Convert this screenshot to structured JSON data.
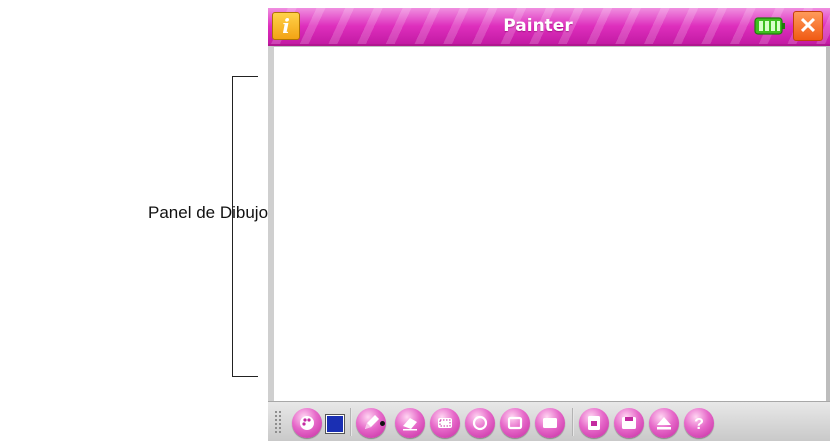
{
  "annotation": {
    "label": "Panel de Dibujo"
  },
  "window": {
    "title": "Painter",
    "info_glyph": "i",
    "close_glyph": "✕",
    "battery_color": "#3fbf1f",
    "titlebar_color": "#de2fbd"
  },
  "toolbar": {
    "current_color": "#1a2fb3",
    "tools": [
      {
        "name": "palette-icon"
      },
      {
        "name": "pencil-icon"
      },
      {
        "name": "eraser-icon"
      },
      {
        "name": "selection-icon"
      },
      {
        "name": "circle-icon"
      },
      {
        "name": "rectangle-outline-icon"
      },
      {
        "name": "rectangle-filled-icon"
      },
      {
        "name": "new-document-icon"
      },
      {
        "name": "save-icon"
      },
      {
        "name": "eject-icon"
      },
      {
        "name": "help-icon"
      }
    ],
    "help_glyph": "?"
  }
}
